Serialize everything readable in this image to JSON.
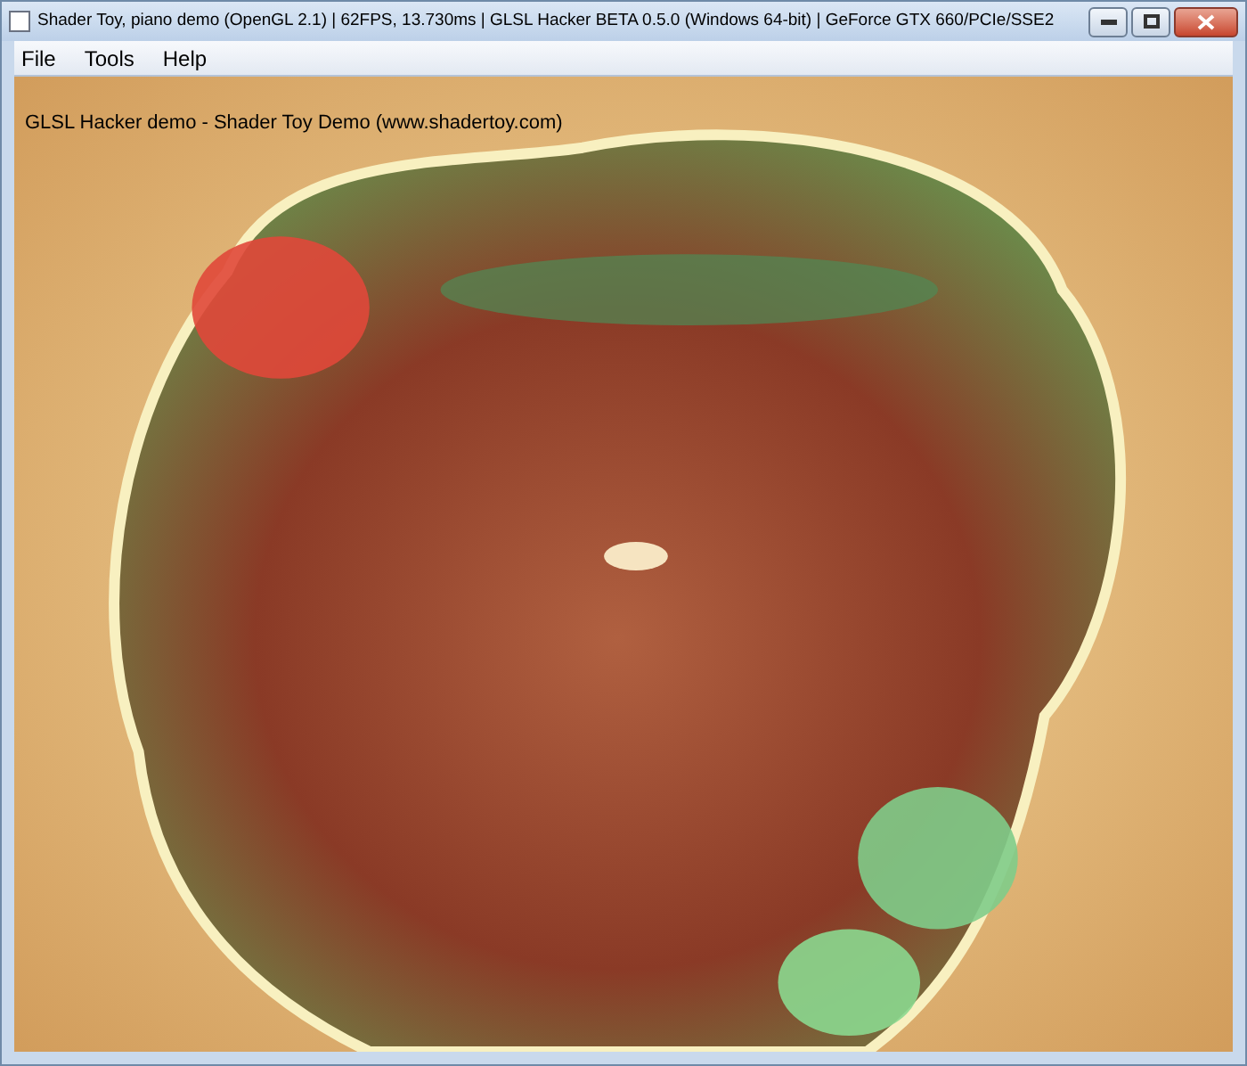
{
  "window": {
    "title": "Shader Toy, piano demo (OpenGL 2.1) | 62FPS, 13.730ms | GLSL Hacker BETA 0.5.0 (Windows 64-bit) | GeForce GTX 660/PCIe/SSE2"
  },
  "menu": [
    {
      "label": "File"
    },
    {
      "label": "Tools"
    },
    {
      "label": "Help"
    }
  ],
  "viewport": {
    "overlay_text": "GLSL Hacker demo - Shader Toy Demo (www.shadertoy.com)"
  }
}
